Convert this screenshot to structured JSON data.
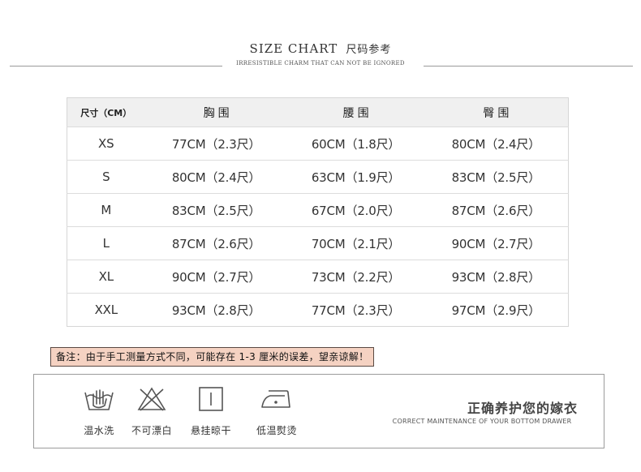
{
  "header": {
    "title_en": "SIZE CHART",
    "title_zh": "尺码参考",
    "subtitle": "IRRESISTIBLE CHARM THAT CAN NOT BE IGNORED"
  },
  "size_table": {
    "columns": [
      "尺寸（CM）",
      "胸 围",
      "腰 围",
      "臀 围"
    ],
    "rows": [
      [
        "XS",
        "77CM（2.3尺）",
        "60CM（1.8尺）",
        "80CM（2.4尺）"
      ],
      [
        "S",
        "80CM（2.4尺）",
        "63CM（1.9尺）",
        "83CM（2.5尺）"
      ],
      [
        "M",
        "83CM（2.5尺）",
        "67CM（2.0尺）",
        "87CM（2.6尺）"
      ],
      [
        "L",
        "87CM（2.6尺）",
        "70CM（2.1尺）",
        "90CM（2.7尺）"
      ],
      [
        "XL",
        "90CM（2.7尺）",
        "73CM（2.2尺）",
        "93CM（2.8尺）"
      ],
      [
        "XXL",
        "93CM（2.8尺）",
        "77CM（2.3尺）",
        "97CM（2.9尺）"
      ]
    ]
  },
  "note": "备注：由于手工测量方式不同，可能存在 1-3 厘米的误差，望亲谅解！",
  "care": {
    "items": [
      {
        "icon": "hand-wash-icon",
        "label": "温水洗"
      },
      {
        "icon": "no-bleach-icon",
        "label": "不可漂白"
      },
      {
        "icon": "hang-dry-icon",
        "label": "悬挂晾干"
      },
      {
        "icon": "low-iron-icon",
        "label": "低温熨烫"
      }
    ],
    "title": "正确养护您的嫁衣",
    "subtitle": "CORRECT MAINTENANCE OF YOUR BOTTOM DRAWER"
  }
}
